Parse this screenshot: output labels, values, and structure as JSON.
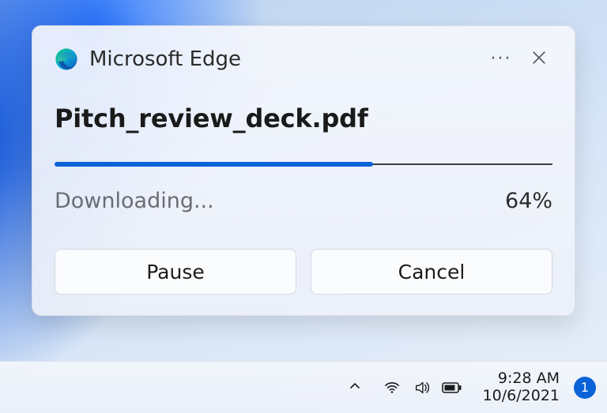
{
  "notification": {
    "app_name": "Microsoft Edge",
    "more_label": "···",
    "close_label": "Close",
    "file_name": "Pitch_review_deck.pdf",
    "status_text": "Downloading...",
    "progress_percent": 64,
    "progress_percent_label": "64%",
    "buttons": {
      "pause": "Pause",
      "cancel": "Cancel"
    }
  },
  "taskbar": {
    "time": "9:28 AM",
    "date": "10/6/2021",
    "badge_count": "1"
  },
  "colors": {
    "accent": "#0b63d8"
  }
}
